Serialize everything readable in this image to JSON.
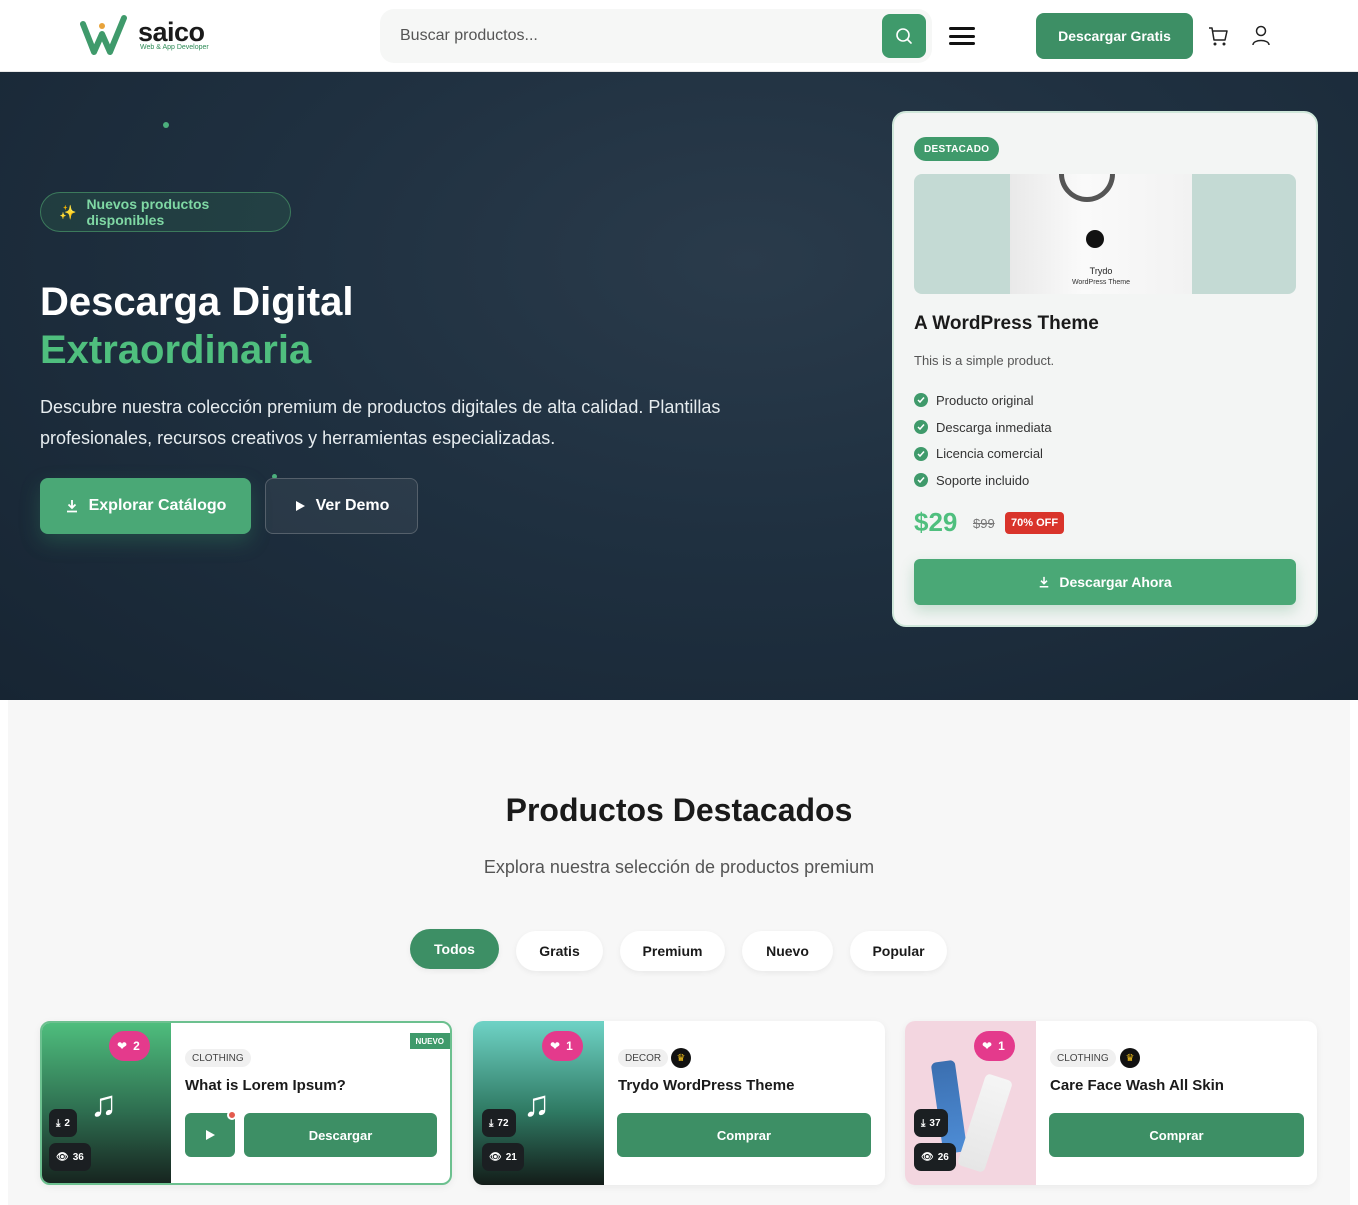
{
  "header": {
    "logo_name": "saico",
    "logo_tagline": "Web & App Developer",
    "search_placeholder": "Buscar productos...",
    "download_free_label": "Descargar Gratis",
    "icons": {
      "search": "search-icon",
      "menu": "hamburger-icon",
      "cart": "cart-icon",
      "user": "user-icon"
    }
  },
  "hero": {
    "badge": "Nuevos productos disponibles",
    "title_line1": "Descarga Digital",
    "title_line2": "Extraordinaria",
    "description": "Descubre nuestra colección premium de productos digitales de alta calidad. Plantillas profesionales, recursos creativos y herramientas especializadas.",
    "explore_label": "Explorar Catálogo",
    "demo_label": "Ver Demo"
  },
  "featured": {
    "badge": "DESTACADO",
    "image_brand": "Trydo",
    "image_caption": "WordPress Theme",
    "title": "A WordPress Theme",
    "subtitle": "This is a simple product.",
    "features": [
      "Producto original",
      "Descarga inmediata",
      "Licencia comercial",
      "Soporte incluido"
    ],
    "price": "$29",
    "old_price": "$99",
    "discount": "70% OFF",
    "cta_label": "Descargar Ahora"
  },
  "products_section": {
    "title": "Productos Destacados",
    "subtitle": "Explora nuestra selección de productos premium",
    "filters": [
      "Todos",
      "Gratis",
      "Premium",
      "Nuevo",
      "Popular"
    ],
    "active_filter": "Todos"
  },
  "products": [
    {
      "category": "CLOTHING",
      "title": "What is Lorem Ipsum?",
      "likes": "2",
      "downloads": "2",
      "views": "36",
      "action": "Descargar",
      "badge": "NUEVO"
    },
    {
      "category": "DECOR",
      "title": "Trydo WordPress Theme",
      "likes": "1",
      "downloads": "72",
      "views": "21",
      "action": "Comprar"
    },
    {
      "category": "CLOTHING",
      "title": "Care Face Wash All Skin",
      "likes": "1",
      "downloads": "37",
      "views": "26",
      "action": "Comprar"
    }
  ],
  "colors": {
    "accent": "#3d8f65",
    "accent_light": "#4fbf7e",
    "hero_bg": "#1f3040",
    "like": "#e43a8c",
    "discount": "#d9342b"
  }
}
